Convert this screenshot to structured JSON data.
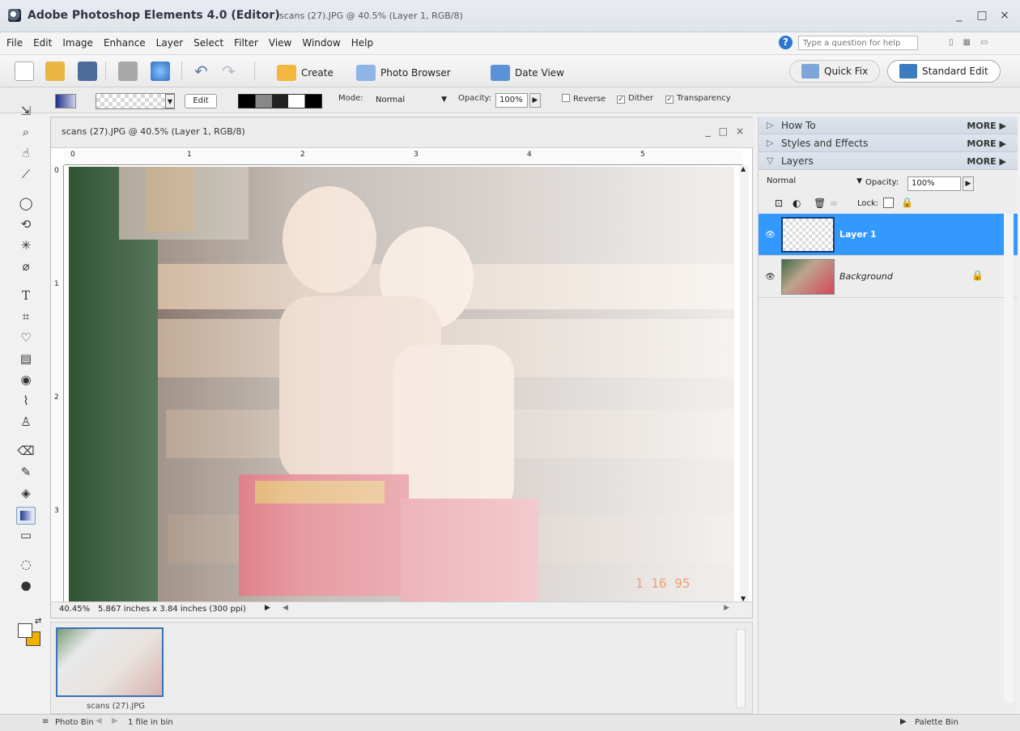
{
  "window": {
    "app_title": "Adobe Photoshop Elements 4.0 (Editor)",
    "doc_title": "scans (27).JPG @ 40.5% (Layer 1, RGB/8)",
    "controls": [
      "_",
      "□",
      "×"
    ]
  },
  "menu": {
    "items": [
      "File",
      "Edit",
      "Image",
      "Enhance",
      "Layer",
      "Select",
      "Filter",
      "View",
      "Window",
      "Help"
    ],
    "help_placeholder": "Type a question for help"
  },
  "shortcuts": {
    "create_label": "Create",
    "photo_browser_label": "Photo Browser",
    "date_view_label": "Date View",
    "quick_fix_label": "Quick Fix",
    "standard_edit_label": "Standard Edit"
  },
  "options": {
    "edit_label": "Edit",
    "mode_label": "Mode:",
    "mode_value": "Normal",
    "opacity_label": "Opacity:",
    "opacity_value": "100%",
    "reverse_label": "Reverse",
    "dither_label": "Dither",
    "transparency_label": "Transparency",
    "reverse_checked": false,
    "dither_checked": true,
    "transparency_checked": true
  },
  "document": {
    "title": "scans (27).JPG @ 40.5% (Layer 1, RGB/8)",
    "controls": [
      "_",
      "□",
      "×"
    ],
    "ruler_marks": [
      "0",
      "1",
      "2",
      "3",
      "4",
      "5"
    ],
    "vertical_marks": [
      "0",
      "1",
      "2",
      "3"
    ],
    "zoom": "40.45%",
    "size_info": "5.867 inches x 3.84 inches (300 ppi)",
    "date_stamp": "1 16 95"
  },
  "photo_bin": {
    "file_name": "scans (27).JPG",
    "bin_label": "Photo Bin",
    "file_count": "1 file in bin",
    "palette_bin_label": "Palette Bin"
  },
  "palette": {
    "how_to": "How To",
    "styles_effects": "Styles and Effects",
    "layers": "Layers",
    "more": "MORE",
    "blend_mode": "Normal",
    "opacity_label": "Opacity:",
    "opacity_value": "100%",
    "lock_label": "Lock:",
    "layers_list": [
      {
        "name": "Layer 1",
        "selected": true
      },
      {
        "name": "Background",
        "selected": false
      }
    ]
  },
  "colors": {
    "selection_blue": "#3399ff",
    "foreground": "#ffffff",
    "background": "#f0b000"
  }
}
